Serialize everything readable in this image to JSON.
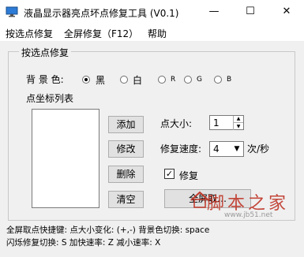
{
  "window": {
    "title": "液晶显示器亮点坏点修复工具 (V0.1)",
    "minimize_glyph": "—",
    "maximize_glyph": "☐",
    "close_glyph": "✕"
  },
  "menu": [
    "按选点修复",
    "全屏修复（F12）",
    "帮助"
  ],
  "group": {
    "title": "按选点修复",
    "bg_label": "背 景 色:",
    "colors": [
      {
        "label": "黑",
        "selected": true
      },
      {
        "label": "白",
        "selected": false
      },
      {
        "label": "R",
        "selected": false
      },
      {
        "label": "G",
        "selected": false
      },
      {
        "label": "B",
        "selected": false
      }
    ],
    "list_label": "点坐标列表",
    "buttons": {
      "add": "添加",
      "modify": "修改",
      "delete": "删除",
      "clear": "清空"
    },
    "dot_size_label": "点大小:",
    "dot_size_value": "1",
    "speed_label": "修复速度:",
    "speed_value": "4",
    "speed_unit": "次/秒",
    "repair_label": "修复",
    "repair_checked": true,
    "fullscreen_button": "全屏取…"
  },
  "watermark": {
    "text": "脚本之家",
    "url": "www.jb51.net"
  },
  "footer": {
    "line1": "全屏取点快捷键: 点大小变化: (+,-)  背景色切换: space",
    "line2": "闪烁修复切换: S 加快速率: Z 减小速率: X"
  },
  "icons": {
    "app": "monitor-icon",
    "checkbox": "check-icon",
    "spin_up": "triangle-up-icon",
    "spin_down": "triangle-down-icon",
    "dropdown": "chevron-down-icon"
  }
}
